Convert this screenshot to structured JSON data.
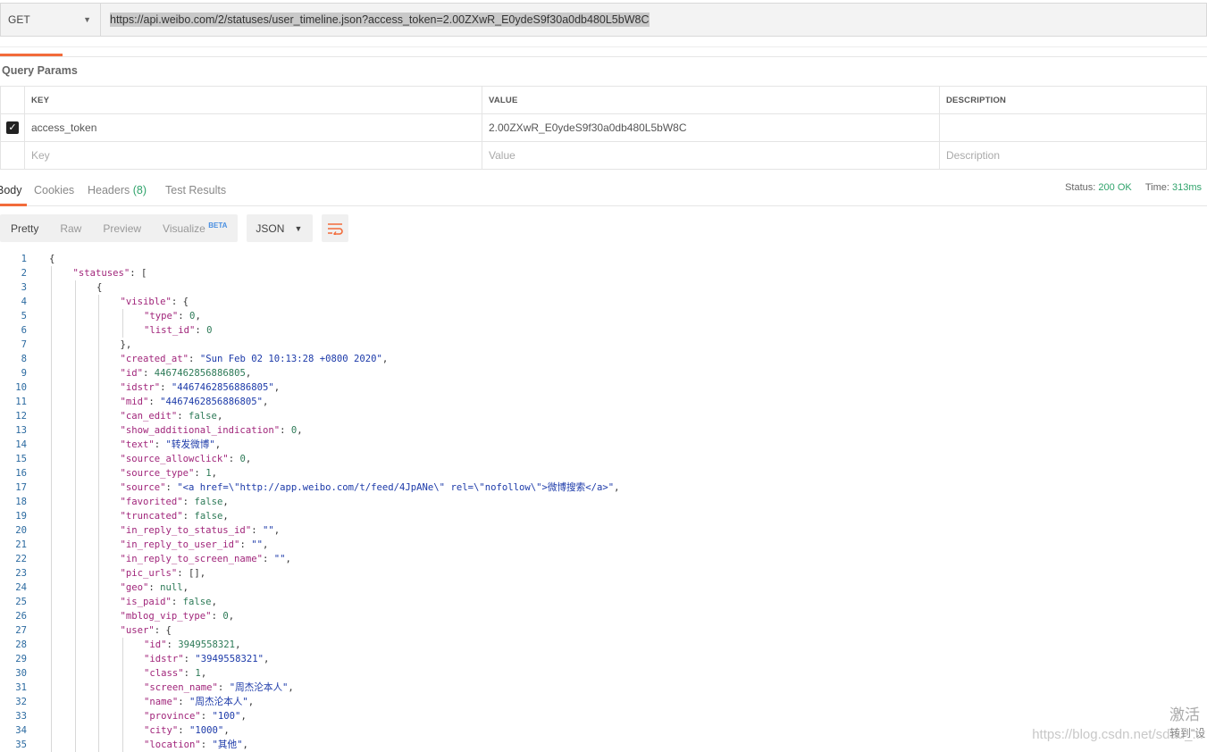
{
  "request": {
    "method": "GET",
    "url": "https://api.weibo.com/2/statuses/user_timeline.json?access_token=2.00ZXwR_E0ydeS9f30a0db480L5bW8C"
  },
  "query_params": {
    "title": "Query Params",
    "headers": [
      "KEY",
      "VALUE",
      "DESCRIPTION"
    ],
    "rows": [
      {
        "key": "access_token",
        "value": "2.00ZXwR_E0ydeS9f30a0db480L5bW8C",
        "description": ""
      }
    ],
    "placeholders": {
      "key": "Key",
      "value": "Value",
      "description": "Description"
    }
  },
  "response_tabs": {
    "body": "Body",
    "cookies": "Cookies",
    "headers": "Headers",
    "headers_count": "(8)",
    "test_results": "Test Results"
  },
  "status": {
    "status_label": "Status:",
    "status_value": "200 OK",
    "time_label": "Time:",
    "time_value": "313ms"
  },
  "view": {
    "pretty": "Pretty",
    "raw": "Raw",
    "preview": "Preview",
    "visualize": "Visualize",
    "beta": "BETA",
    "format": "JSON"
  },
  "code_lines": [
    {
      "n": "1",
      "i": 0,
      "t": [
        [
          "p",
          "{"
        ]
      ]
    },
    {
      "n": "2",
      "i": 1,
      "t": [
        [
          "k",
          "\"statuses\""
        ],
        [
          "p",
          ": ["
        ]
      ]
    },
    {
      "n": "3",
      "i": 2,
      "t": [
        [
          "p",
          "{"
        ]
      ]
    },
    {
      "n": "4",
      "i": 3,
      "t": [
        [
          "k",
          "\"visible\""
        ],
        [
          "p",
          ": {"
        ]
      ]
    },
    {
      "n": "5",
      "i": 4,
      "t": [
        [
          "k",
          "\"type\""
        ],
        [
          "p",
          ": "
        ],
        [
          "n",
          "0"
        ],
        [
          "p",
          ","
        ]
      ]
    },
    {
      "n": "6",
      "i": 4,
      "t": [
        [
          "k",
          "\"list_id\""
        ],
        [
          "p",
          ": "
        ],
        [
          "n",
          "0"
        ]
      ]
    },
    {
      "n": "7",
      "i": 3,
      "t": [
        [
          "p",
          "},"
        ]
      ]
    },
    {
      "n": "8",
      "i": 3,
      "t": [
        [
          "k",
          "\"created_at\""
        ],
        [
          "p",
          ": "
        ],
        [
          "s",
          "\"Sun Feb 02 10:13:28 +0800 2020\""
        ],
        [
          "p",
          ","
        ]
      ]
    },
    {
      "n": "9",
      "i": 3,
      "t": [
        [
          "k",
          "\"id\""
        ],
        [
          "p",
          ": "
        ],
        [
          "n",
          "4467462856886805"
        ],
        [
          "p",
          ","
        ]
      ]
    },
    {
      "n": "10",
      "i": 3,
      "t": [
        [
          "k",
          "\"idstr\""
        ],
        [
          "p",
          ": "
        ],
        [
          "s",
          "\"4467462856886805\""
        ],
        [
          "p",
          ","
        ]
      ]
    },
    {
      "n": "11",
      "i": 3,
      "t": [
        [
          "k",
          "\"mid\""
        ],
        [
          "p",
          ": "
        ],
        [
          "s",
          "\"4467462856886805\""
        ],
        [
          "p",
          ","
        ]
      ]
    },
    {
      "n": "12",
      "i": 3,
      "t": [
        [
          "k",
          "\"can_edit\""
        ],
        [
          "p",
          ": "
        ],
        [
          "n",
          "false"
        ],
        [
          "p",
          ","
        ]
      ]
    },
    {
      "n": "13",
      "i": 3,
      "t": [
        [
          "k",
          "\"show_additional_indication\""
        ],
        [
          "p",
          ": "
        ],
        [
          "n",
          "0"
        ],
        [
          "p",
          ","
        ]
      ]
    },
    {
      "n": "14",
      "i": 3,
      "t": [
        [
          "k",
          "\"text\""
        ],
        [
          "p",
          ": "
        ],
        [
          "s",
          "\"转发微博\""
        ],
        [
          "p",
          ","
        ]
      ]
    },
    {
      "n": "15",
      "i": 3,
      "t": [
        [
          "k",
          "\"source_allowclick\""
        ],
        [
          "p",
          ": "
        ],
        [
          "n",
          "0"
        ],
        [
          "p",
          ","
        ]
      ]
    },
    {
      "n": "16",
      "i": 3,
      "t": [
        [
          "k",
          "\"source_type\""
        ],
        [
          "p",
          ": "
        ],
        [
          "n",
          "1"
        ],
        [
          "p",
          ","
        ]
      ]
    },
    {
      "n": "17",
      "i": 3,
      "t": [
        [
          "k",
          "\"source\""
        ],
        [
          "p",
          ": "
        ],
        [
          "s",
          "\"<a href=\\\"http://app.weibo.com/t/feed/4JpANe\\\" rel=\\\"nofollow\\\">微博搜索</a>\""
        ],
        [
          "p",
          ","
        ]
      ]
    },
    {
      "n": "18",
      "i": 3,
      "t": [
        [
          "k",
          "\"favorited\""
        ],
        [
          "p",
          ": "
        ],
        [
          "n",
          "false"
        ],
        [
          "p",
          ","
        ]
      ]
    },
    {
      "n": "19",
      "i": 3,
      "t": [
        [
          "k",
          "\"truncated\""
        ],
        [
          "p",
          ": "
        ],
        [
          "n",
          "false"
        ],
        [
          "p",
          ","
        ]
      ]
    },
    {
      "n": "20",
      "i": 3,
      "t": [
        [
          "k",
          "\"in_reply_to_status_id\""
        ],
        [
          "p",
          ": "
        ],
        [
          "s",
          "\"\""
        ],
        [
          "p",
          ","
        ]
      ]
    },
    {
      "n": "21",
      "i": 3,
      "t": [
        [
          "k",
          "\"in_reply_to_user_id\""
        ],
        [
          "p",
          ": "
        ],
        [
          "s",
          "\"\""
        ],
        [
          "p",
          ","
        ]
      ]
    },
    {
      "n": "22",
      "i": 3,
      "t": [
        [
          "k",
          "\"in_reply_to_screen_name\""
        ],
        [
          "p",
          ": "
        ],
        [
          "s",
          "\"\""
        ],
        [
          "p",
          ","
        ]
      ]
    },
    {
      "n": "23",
      "i": 3,
      "t": [
        [
          "k",
          "\"pic_urls\""
        ],
        [
          "p",
          ": [],"
        ]
      ]
    },
    {
      "n": "24",
      "i": 3,
      "t": [
        [
          "k",
          "\"geo\""
        ],
        [
          "p",
          ": "
        ],
        [
          "n",
          "null"
        ],
        [
          "p",
          ","
        ]
      ]
    },
    {
      "n": "25",
      "i": 3,
      "t": [
        [
          "k",
          "\"is_paid\""
        ],
        [
          "p",
          ": "
        ],
        [
          "n",
          "false"
        ],
        [
          "p",
          ","
        ]
      ]
    },
    {
      "n": "26",
      "i": 3,
      "t": [
        [
          "k",
          "\"mblog_vip_type\""
        ],
        [
          "p",
          ": "
        ],
        [
          "n",
          "0"
        ],
        [
          "p",
          ","
        ]
      ]
    },
    {
      "n": "27",
      "i": 3,
      "t": [
        [
          "k",
          "\"user\""
        ],
        [
          "p",
          ": {"
        ]
      ]
    },
    {
      "n": "28",
      "i": 4,
      "t": [
        [
          "k",
          "\"id\""
        ],
        [
          "p",
          ": "
        ],
        [
          "n",
          "3949558321"
        ],
        [
          "p",
          ","
        ]
      ]
    },
    {
      "n": "29",
      "i": 4,
      "t": [
        [
          "k",
          "\"idstr\""
        ],
        [
          "p",
          ": "
        ],
        [
          "s",
          "\"3949558321\""
        ],
        [
          "p",
          ","
        ]
      ]
    },
    {
      "n": "30",
      "i": 4,
      "t": [
        [
          "k",
          "\"class\""
        ],
        [
          "p",
          ": "
        ],
        [
          "n",
          "1"
        ],
        [
          "p",
          ","
        ]
      ]
    },
    {
      "n": "31",
      "i": 4,
      "t": [
        [
          "k",
          "\"screen_name\""
        ],
        [
          "p",
          ": "
        ],
        [
          "s",
          "\"周杰沦本人\""
        ],
        [
          "p",
          ","
        ]
      ]
    },
    {
      "n": "32",
      "i": 4,
      "t": [
        [
          "k",
          "\"name\""
        ],
        [
          "p",
          ": "
        ],
        [
          "s",
          "\"周杰沦本人\""
        ],
        [
          "p",
          ","
        ]
      ]
    },
    {
      "n": "33",
      "i": 4,
      "t": [
        [
          "k",
          "\"province\""
        ],
        [
          "p",
          ": "
        ],
        [
          "s",
          "\"100\""
        ],
        [
          "p",
          ","
        ]
      ]
    },
    {
      "n": "34",
      "i": 4,
      "t": [
        [
          "k",
          "\"city\""
        ],
        [
          "p",
          ": "
        ],
        [
          "s",
          "\"1000\""
        ],
        [
          "p",
          ","
        ]
      ]
    },
    {
      "n": "35",
      "i": 4,
      "t": [
        [
          "k",
          "\"location\""
        ],
        [
          "p",
          ": "
        ],
        [
          "s",
          "\"其他\""
        ],
        [
          "p",
          ","
        ]
      ]
    }
  ],
  "watermark": {
    "csdn": "https://blog.csdn.net/sdau_...",
    "activate": "激活",
    "goto": "转到\"设"
  }
}
